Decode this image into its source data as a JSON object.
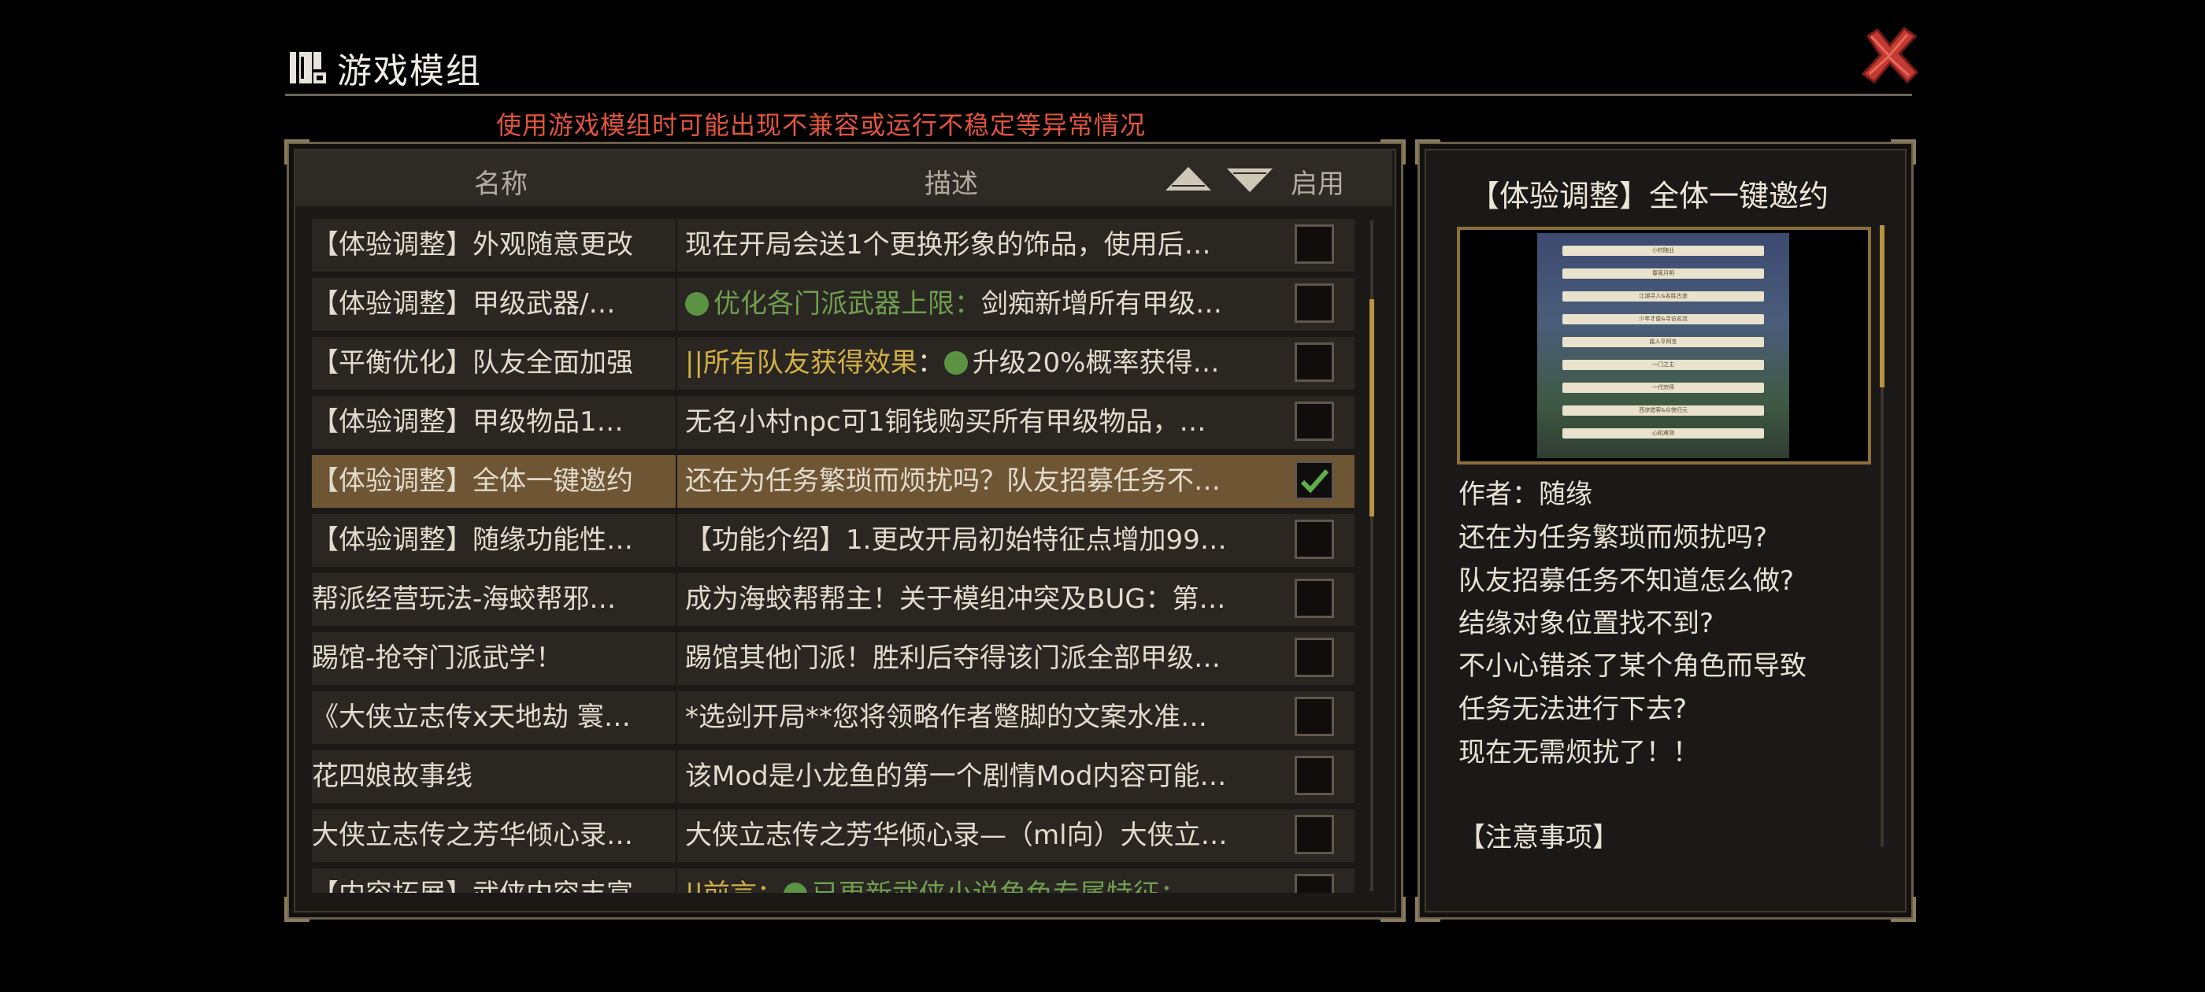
{
  "window": {
    "title": "游戏模组",
    "warning": "使用游戏模组时可能出现不兼容或运行不稳定等异常情况"
  },
  "table": {
    "col_name": "名称",
    "col_desc": "描述",
    "col_enable": "启用",
    "rows": [
      {
        "name": "【体验调整】外观随意更改",
        "desc": [
          {
            "t": "现在开局会送1个更换形象的饰品，使用后…"
          }
        ],
        "enabled": false,
        "selected": false
      },
      {
        "name": "【体验调整】甲级武器/…",
        "desc": [
          {
            "dot": true
          },
          {
            "t": "优化各门派武器上限：",
            "c": "green"
          },
          {
            "t": "剑痴新增所有甲级…"
          }
        ],
        "enabled": false,
        "selected": false
      },
      {
        "name": "【平衡优化】队友全面加强",
        "desc": [
          {
            "t": "||所有队友获得效果",
            "c": "gold"
          },
          {
            "t": "："
          },
          {
            "dot": true
          },
          {
            "t": "升级20%概率获得…"
          }
        ],
        "enabled": false,
        "selected": false
      },
      {
        "name": "【体验调整】甲级物品1…",
        "desc": [
          {
            "t": "无名小村npc可1铜钱购买所有甲级物品，…"
          }
        ],
        "enabled": false,
        "selected": false
      },
      {
        "name": "【体验调整】全体一键邀约",
        "desc": [
          {
            "t": "还在为任务繁琐而烦扰吗？队友招募任务不…"
          }
        ],
        "enabled": true,
        "selected": true
      },
      {
        "name": "【体验调整】随缘功能性…",
        "desc": [
          {
            "t": "【功能介绍】1.更改开局初始特征点增加99…"
          }
        ],
        "enabled": false,
        "selected": false
      },
      {
        "name": "帮派经营玩法-海蛟帮邪…",
        "desc": [
          {
            "t": "成为海蛟帮帮主！关于模组冲突及BUG：第…"
          }
        ],
        "enabled": false,
        "selected": false
      },
      {
        "name": "踢馆-抢夺门派武学！",
        "desc": [
          {
            "t": "踢馆其他门派！胜利后夺得该门派全部甲级…"
          }
        ],
        "enabled": false,
        "selected": false
      },
      {
        "name": "《大侠立志传x天地劫 寰…",
        "desc": [
          {
            "t": "*选剑开局**您将领略作者蹩脚的文案水准…"
          }
        ],
        "enabled": false,
        "selected": false
      },
      {
        "name": "花四娘故事线",
        "desc": [
          {
            "t": "该Mod是小龙鱼的第一个剧情Mod内容可能…"
          }
        ],
        "enabled": false,
        "selected": false
      },
      {
        "name": "大侠立志传之芳华倾心录…",
        "desc": [
          {
            "t": "大侠立志传之芳华倾心录—（ml向）大侠立…"
          }
        ],
        "enabled": false,
        "selected": false
      },
      {
        "name": "【内容拓展】武侠内容丰富",
        "desc": [
          {
            "t": "||前言：",
            "c": "gold"
          },
          {
            "dot": true
          },
          {
            "t": "已更新武侠小说角色专属特征：…",
            "c": "green"
          }
        ],
        "enabled": false,
        "selected": false
      }
    ]
  },
  "detail": {
    "title": "【体验调整】全体一键邀约",
    "lines": [
      "作者：随缘",
      "还在为任务繁琐而烦扰吗?",
      "队友招募任务不知道怎么做?",
      "结缘对象位置找不到?",
      "不小心错杀了某个角色而导致",
      "任务无法进行下去?",
      "现在无需烦扰了！！",
      "",
      "【注意事项】"
    ],
    "preview_menu": [
      "小村随业",
      "春宵月明",
      "江湖寻人&名胜古迹",
      "少年才俊&寻访名流",
      "路人平阿言",
      "一门之主",
      "一代宗师",
      "西凉猎客&众侠归元",
      "心机难测"
    ]
  },
  "colors": {
    "warning": "#e0553e",
    "accent_gold": "#b8923e",
    "selected_row": "#6e5534",
    "check_green": "#5eb04a",
    "close_red": "#c23a32"
  }
}
